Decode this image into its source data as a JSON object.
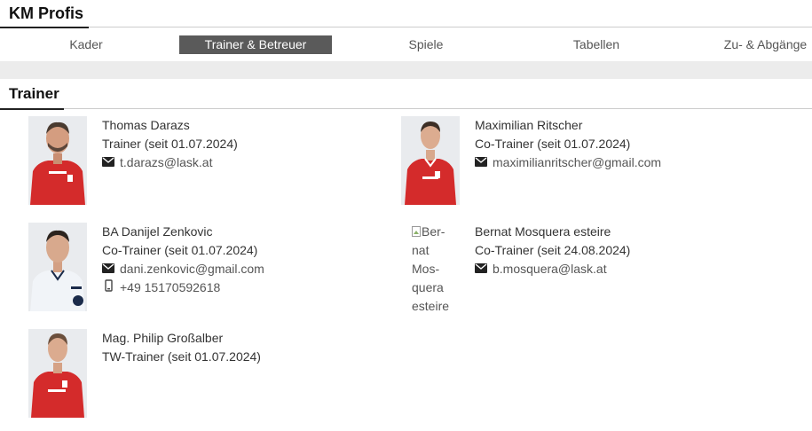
{
  "team": {
    "title": "KM Profis"
  },
  "tabs": [
    {
      "label": "Kader"
    },
    {
      "label": "Trainer & Betreuer"
    },
    {
      "label": "Spiele"
    },
    {
      "label": "Tabellen"
    },
    {
      "label": "Zu- & Abgänge"
    }
  ],
  "section": {
    "title": "Trainer"
  },
  "people": [
    {
      "name": "Thomas Darazs",
      "role": "Trainer (seit 01.07.2024)",
      "email": "t.darazs@lask.at"
    },
    {
      "name": "Maximilian Ritscher",
      "role": "Co-Trainer (seit 01.07.2024)",
      "email": "maximilianritscher@gmail.com"
    },
    {
      "name": "BA Danijel Zenkovic",
      "role": "Co-Trainer (seit 01.07.2024)",
      "email": "dani.zenkovic@gmail.com",
      "phone": "+49 15170592618"
    },
    {
      "name": "Bernat Mosquera esteire",
      "role": "Co-Trainer (seit 24.08.2024)",
      "email": "b.mosquera@lask.at",
      "photo_alt": "Ber- nat Mos- quera esteire"
    },
    {
      "name": "Mag. Philip Großalber",
      "role": "TW-Trainer (seit 01.07.2024)"
    }
  ],
  "colors": {
    "active_tab": "#5a5a5a",
    "jersey_red": "#d42b2b",
    "jersey_white": "#f1f4f8",
    "band": "#ececec"
  },
  "icons": {
    "email": "envelope-icon",
    "phone": "mobile-phone-icon"
  }
}
